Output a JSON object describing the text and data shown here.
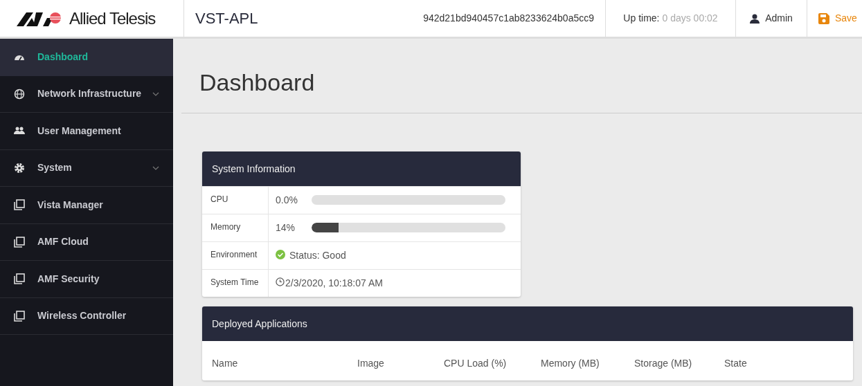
{
  "header": {
    "brand": "Allied Telesis",
    "device_name": "VST-APL",
    "device_id": "942d21bd940457c1ab8233624b0a5cc9",
    "uptime_label": "Up time:",
    "uptime_value": "0 days 00:02",
    "user": "Admin",
    "save": "Save"
  },
  "sidebar": {
    "items": [
      {
        "label": "Dashboard",
        "kind": "gauge",
        "selected": true,
        "has_submenu": false
      },
      {
        "label": "Network Infrastructure",
        "kind": "globe",
        "selected": false,
        "has_submenu": true
      },
      {
        "label": "User Management",
        "kind": "users",
        "selected": false,
        "has_submenu": false
      },
      {
        "label": "System",
        "kind": "gear",
        "selected": false,
        "has_submenu": true
      },
      {
        "label": "Vista Manager",
        "kind": "windows",
        "selected": false,
        "has_submenu": false
      },
      {
        "label": "AMF Cloud",
        "kind": "windows",
        "selected": false,
        "has_submenu": false
      },
      {
        "label": "AMF Security",
        "kind": "windows",
        "selected": false,
        "has_submenu": false
      },
      {
        "label": "Wireless Controller",
        "kind": "windows",
        "selected": false,
        "has_submenu": false
      }
    ]
  },
  "page_title": "Dashboard",
  "system_information": {
    "title": "System Information",
    "rows": [
      {
        "kind": "meter",
        "label": "CPU",
        "value": "0.0%",
        "level": 0.0
      },
      {
        "kind": "meter",
        "label": "Memory",
        "value": "14%",
        "level": 0.14
      },
      {
        "kind": "status",
        "label": "Environment",
        "value": "Status: Good"
      },
      {
        "kind": "time",
        "label": "System Time",
        "value": "2/3/2020, 10:18:07 AM"
      }
    ]
  },
  "deployed_applications": {
    "title": "Deployed Applications",
    "columns": [
      "Name",
      "Image",
      "CPU Load (%)",
      "Memory (MB)",
      "Storage (MB)",
      "State"
    ]
  }
}
